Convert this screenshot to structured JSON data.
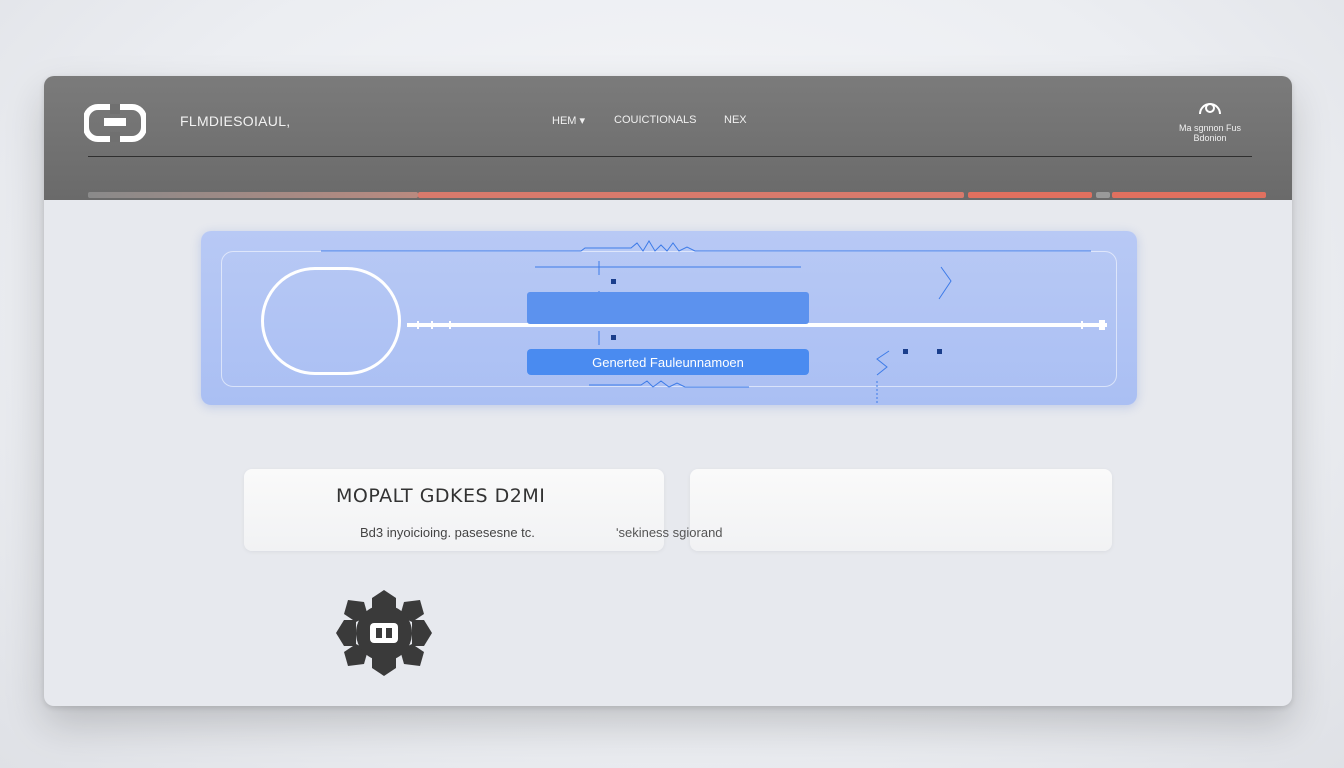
{
  "header": {
    "brand": "FLMDIESOIAUL,",
    "nav": [
      "HEM ▾",
      "COUICTIONALS",
      "NEX"
    ],
    "account": {
      "line1": "Ma sgnnon  Fus",
      "line2": "Bdonion"
    }
  },
  "hero": {
    "button_label": "Generted Fauleunnamoen"
  },
  "cards": {
    "card1": {
      "title": "MOPALT GDKES D2MI",
      "subtitle": "Bd3 inyoicioing.  pasesesne tc."
    },
    "card2": {
      "subtitle": "ʹsekiness  sgiorand"
    }
  },
  "colors": {
    "header_bg": "#707070",
    "accent_red": "#e07060",
    "hero_bg": "#b8c9f5",
    "button_blue": "#4a8bf0"
  },
  "icons": {
    "logo": "link-logo-icon",
    "account": "user-icon",
    "gear": "gear-icon"
  }
}
